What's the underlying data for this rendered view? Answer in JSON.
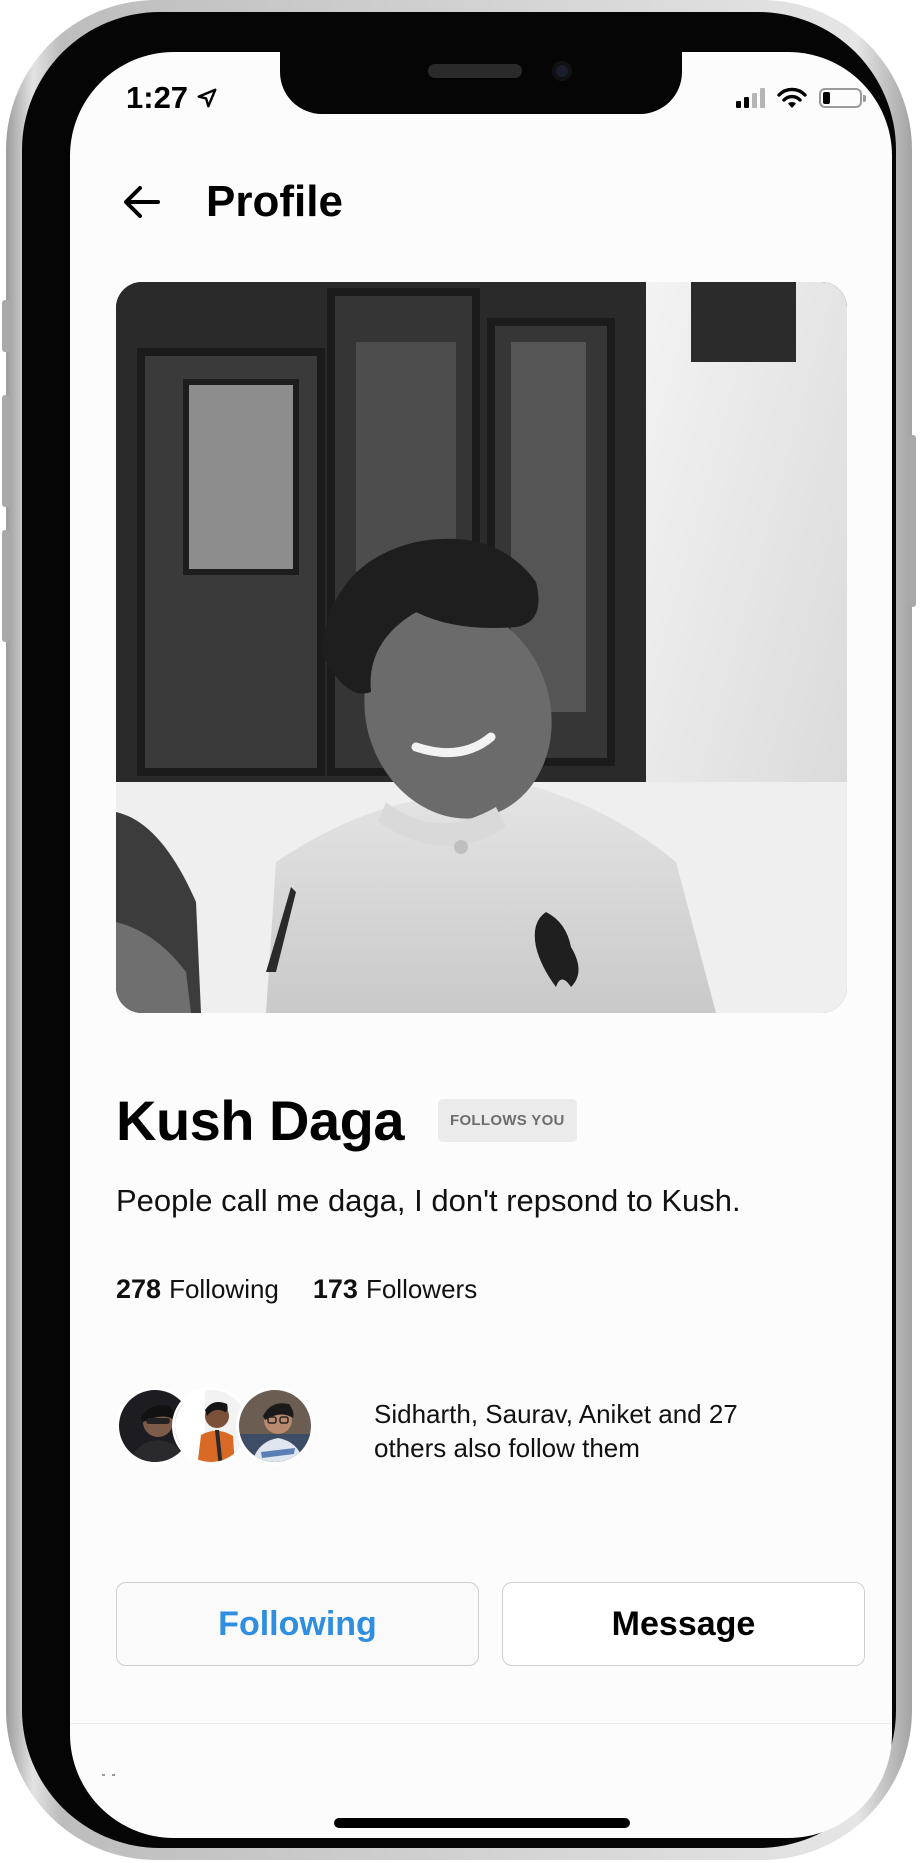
{
  "status_bar": {
    "time": "1:27",
    "location_icon": "location-arrow-icon",
    "signal_icon": "cellular-signal-icon",
    "wifi_icon": "wifi-icon",
    "battery_icon": "battery-icon",
    "battery_level": 0.2
  },
  "header": {
    "back_icon": "back-arrow-icon",
    "title": "Profile"
  },
  "profile": {
    "photo_alt": "Profile photo",
    "name": "Kush Daga",
    "badge": "FOLLOWS YOU",
    "bio": "People call me daga, I don't repsond to Kush.",
    "following_count": "278",
    "following_label": "Following",
    "followers_count": "173",
    "followers_label": "Followers"
  },
  "mutuals": {
    "avatars": [
      "Sidharth",
      "Saurav",
      "Aniket"
    ],
    "text": "Sidharth, Saurav, Aniket and 27 others also follow them"
  },
  "actions": {
    "following_label": "Following",
    "message_label": "Message"
  },
  "colors": {
    "accent": "#2f8ee0",
    "badge_bg": "#ebebeb",
    "badge_text": "#6d6d6d"
  }
}
